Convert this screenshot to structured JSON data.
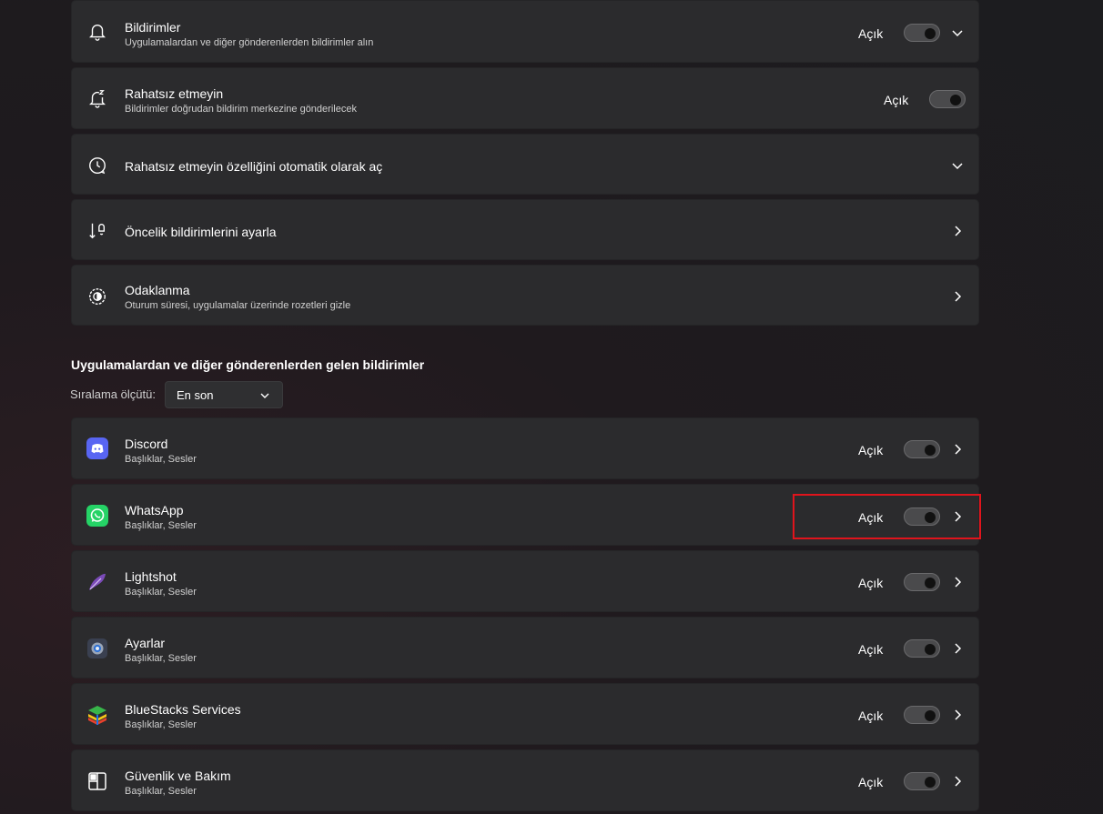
{
  "top_settings": [
    {
      "title": "Bildirimler",
      "subtitle": "Uygulamalardan ve diğer gönderenlerden bildirimler alın",
      "state": "Açık",
      "icon": "bell-icon"
    },
    {
      "title": "Rahatsız etmeyin",
      "subtitle": "Bildirimler doğrudan bildirim merkezine gönderilecek",
      "state": "Açık",
      "icon": "bell-snooze-icon"
    },
    {
      "title": "Rahatsız etmeyin özelliğini otomatik olarak aç",
      "icon": "clock-icon"
    },
    {
      "title": "Öncelik bildirimlerini ayarla",
      "icon": "priority-sort-icon"
    },
    {
      "title": "Odaklanma",
      "subtitle": "Oturum süresi, uygulamalar üzerinde rozetleri gizle",
      "icon": "focus-icon"
    }
  ],
  "apps_section": {
    "title": "Uygulamalardan ve diğer gönderenlerden gelen bildirimler",
    "sort_label": "Sıralama ölçütü:",
    "sort_value": "En son"
  },
  "apps": [
    {
      "name": "Discord",
      "subtitle": "Başlıklar, Sesler",
      "state": "Açık",
      "icon": "discord-icon"
    },
    {
      "name": "WhatsApp",
      "subtitle": "Başlıklar, Sesler",
      "state": "Açık",
      "icon": "whatsapp-icon"
    },
    {
      "name": "Lightshot",
      "subtitle": "Başlıklar, Sesler",
      "state": "Açık",
      "icon": "lightshot-feather-icon"
    },
    {
      "name": "Ayarlar",
      "subtitle": "Başlıklar, Sesler",
      "state": "Açık",
      "icon": "settings-gear-icon"
    },
    {
      "name": "BlueStacks Services",
      "subtitle": "Başlıklar, Sesler",
      "state": "Açık",
      "icon": "bluestacks-icon"
    },
    {
      "name": "Güvenlik ve Bakım",
      "subtitle": "Başlıklar, Sesler",
      "state": "Açık",
      "icon": "security-maintenance-icon"
    }
  ],
  "colors": {
    "card_bg": "#2b2b2d",
    "highlight": "#e0141c",
    "discord": "#5865f2",
    "whatsapp": "#25d366"
  }
}
